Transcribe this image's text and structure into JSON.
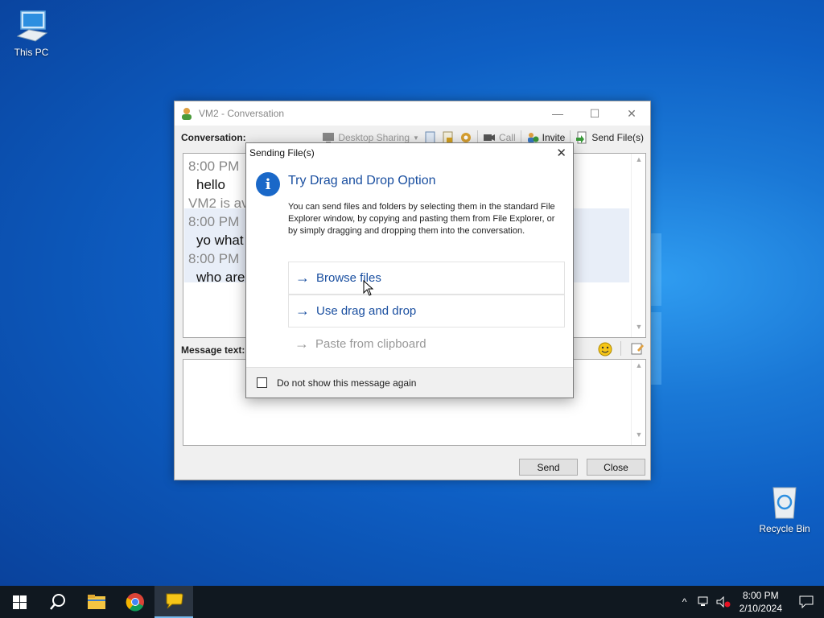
{
  "desktop": {
    "icons": [
      {
        "label": "This PC",
        "icon": "computer-icon"
      },
      {
        "label": "Recycle Bin",
        "icon": "recycle-bin-icon"
      }
    ]
  },
  "conversation_window": {
    "title": "VM2 - Conversation",
    "controls": {
      "minimize": "—",
      "maximize": "☐",
      "close": "✕"
    },
    "conversation_label": "Conversation:",
    "toolbar": {
      "desktop_sharing": "Desktop Sharing",
      "call": "Call",
      "invite": "Invite",
      "send_files": "Send File(s)"
    },
    "messages": [
      {
        "time": "8:00 PM",
        "text": "hello"
      },
      {
        "status": "VM2 is av"
      },
      {
        "time": "8:00 PM",
        "text": "yo what"
      },
      {
        "time": "8:00 PM",
        "text": "who are"
      }
    ],
    "message_text_label": "Message text:",
    "send_button": "Send",
    "close_button": "Close"
  },
  "dialog": {
    "title": "Sending File(s)",
    "close": "✕",
    "heading": "Try Drag and Drop Option",
    "body": "You can send files and folders by selecting them in the standard File Explorer window, by copying and pasting them from File Explorer, or by simply dragging and dropping them into the conversation.",
    "options": [
      {
        "label": "Browse files",
        "enabled": true
      },
      {
        "label": "Use drag and drop",
        "enabled": true
      },
      {
        "label": "Paste from clipboard",
        "enabled": false
      }
    ],
    "arrow": "→",
    "dont_show_label": "Do not show this message again"
  },
  "taskbar": {
    "apps": [
      "start-icon",
      "search-icon",
      "file-explorer-icon",
      "chrome-icon",
      "messenger-icon"
    ],
    "clock_time": "8:00 PM",
    "clock_date": "2/10/2024",
    "tray_chevron": "^"
  },
  "colors": {
    "desktop_blue": "#0e5fc4",
    "link_blue": "#1a4fa0",
    "info_blue": "#1a68c8",
    "taskbar": "#101820"
  }
}
